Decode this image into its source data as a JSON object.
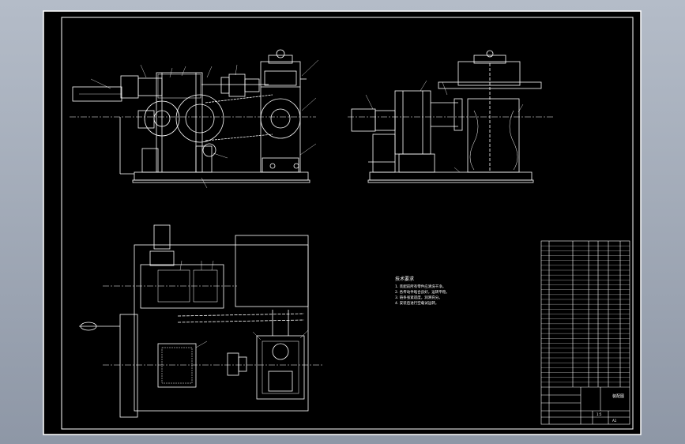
{
  "viewer": {
    "background_top": "#b4bcc8",
    "background_bottom": "#8e97a6",
    "sheet_color": "#000000",
    "line_color": "#ffffff"
  },
  "notes": {
    "heading": "技术要求",
    "lines": [
      "1. 装配前所有零件应清洗干净。",
      "2. 各传动件啮合良好，运转平稳。",
      "3. 链条张紧适度，润滑充分。",
      "4. 安装后进行空载试运转。"
    ]
  },
  "title_block": {
    "drawing_title": "装配图",
    "scale_label": "1:5",
    "sheet_label": "A1"
  },
  "parts_list": {
    "row_count": 30
  }
}
